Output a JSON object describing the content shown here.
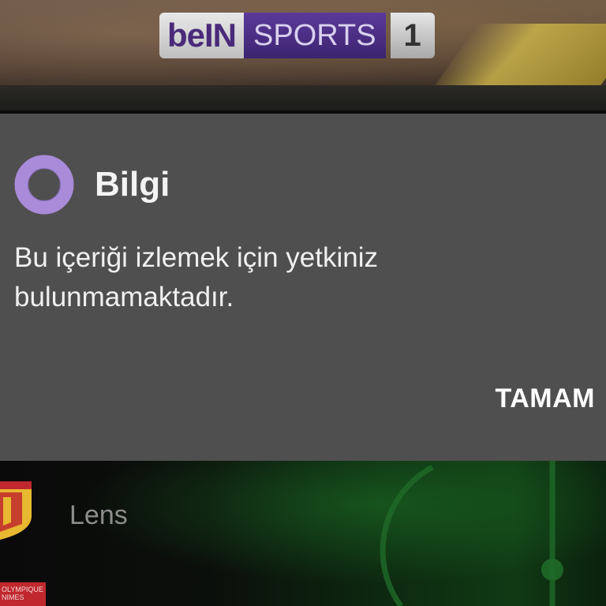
{
  "channel": {
    "brand": "beIN",
    "sports": "SPORTS",
    "number": "1"
  },
  "dialog": {
    "icon": "info-ring-icon",
    "title": "Bilgi",
    "message": "Bu içeriği izlemek için yetkiniz bulunmamaktadır.",
    "ok_label": "TAMAM"
  },
  "match": {
    "team_name": "Lens",
    "crest_icon": "rc-lens-crest-icon",
    "second_badge_text": "OLYMPIQUE NIMES"
  },
  "colors": {
    "dialog_bg": "#4f4f4f",
    "icon_purple": "#a98bd9",
    "brand_purple": "#4a2a7a"
  }
}
